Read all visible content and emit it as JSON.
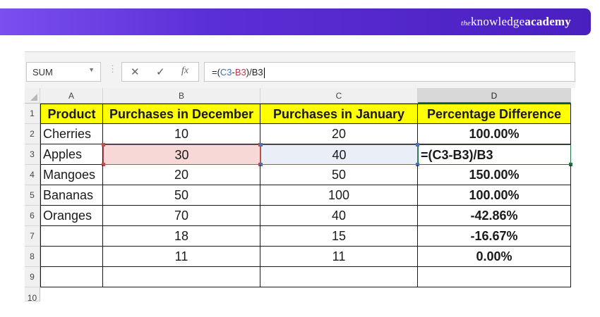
{
  "brand": {
    "prefix": "the",
    "name": "knowledge",
    "suffix": "academy"
  },
  "formula_bar": {
    "name_box": "SUM",
    "cancel_icon": "✕",
    "enter_icon": "✓",
    "fx_label": "fx",
    "formula_prefix": "=(",
    "formula_ref_c": "C3",
    "formula_minus": "-",
    "formula_ref_b": "B3",
    "formula_suffix": ")/B3"
  },
  "columns": [
    "A",
    "B",
    "C",
    "D"
  ],
  "rows": [
    "1",
    "2",
    "3",
    "4",
    "5",
    "6",
    "7",
    "8",
    "9",
    "10"
  ],
  "headers": [
    "Product",
    "Purchases in December",
    "Purchases in January",
    "Percentage Difference"
  ],
  "data": [
    {
      "product": "Cherries",
      "dec": "10",
      "jan": "20",
      "diff": "100.00%"
    },
    {
      "product": "Apples",
      "dec": "30",
      "jan": "40",
      "diff": "=(C3-B3)/B3"
    },
    {
      "product": "Mangoes",
      "dec": "20",
      "jan": "50",
      "diff": "150.00%"
    },
    {
      "product": "Bananas",
      "dec": "50",
      "jan": "100",
      "diff": "100.00%"
    },
    {
      "product": "Oranges",
      "dec": "70",
      "jan": "40",
      "diff": "-42.86%"
    },
    {
      "product": "",
      "dec": "18",
      "jan": "15",
      "diff": "-16.67%"
    },
    {
      "product": "",
      "dec": "11",
      "jan": "11",
      "diff": "0.00%"
    },
    {
      "product": "",
      "dec": "",
      "jan": "",
      "diff": ""
    }
  ],
  "colors": {
    "banner_start": "#7a4ff0",
    "banner_end": "#4a1fc0",
    "header_fill": "#ffff00",
    "ref_b_fill": "#f8d7d7",
    "ref_c_fill": "#e9eef7",
    "ref_c_border": "#4472c4",
    "active_border": "#217346"
  }
}
